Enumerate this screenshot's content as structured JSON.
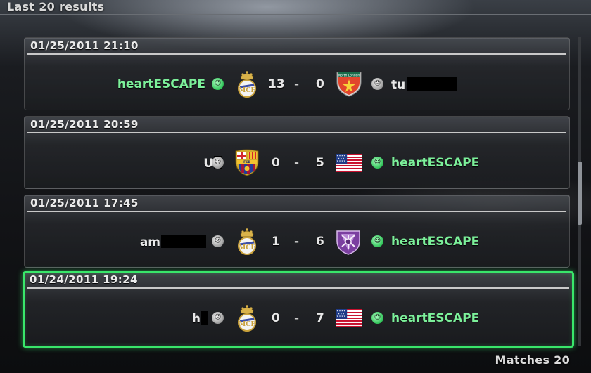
{
  "header": {
    "title": "Last 20 results"
  },
  "footer": {
    "matches_label": "Matches 20"
  },
  "colors": {
    "accent_green": "#39e66a",
    "name_green": "#7cf09a"
  },
  "results": [
    {
      "datetime": "01/25/2011 21:10",
      "home": {
        "name": "heartESCAPE",
        "name_color": "green",
        "status_icon": "green-smile-ball-icon",
        "crest": "real-madrid-crest-icon"
      },
      "home_score": "13",
      "separator": "-",
      "away_score": "0",
      "away": {
        "name": "tu",
        "name_color": "white",
        "status_icon": "grey-sad-ball-icon",
        "crest": "north-london-crest-icon"
      }
    },
    {
      "datetime": "01/25/2011 20:59",
      "home": {
        "name": "U",
        "name_color": "white",
        "status_icon": "grey-sad-ball-icon",
        "crest": "barcelona-crest-icon"
      },
      "home_score": "0",
      "separator": "-",
      "away_score": "5",
      "away": {
        "name": "heartESCAPE",
        "name_color": "green",
        "status_icon": "green-smile-ball-icon",
        "crest": "usa-flag-icon"
      }
    },
    {
      "datetime": "01/25/2011 17:45",
      "home": {
        "name": "am",
        "name_color": "white",
        "status_icon": "grey-sad-ball-icon",
        "crest": "real-madrid-crest-icon"
      },
      "home_score": "1",
      "separator": "-",
      "away_score": "6",
      "away": {
        "name": "heartESCAPE",
        "name_color": "green",
        "status_icon": "green-smile-ball-icon",
        "crest": "purple-shield-crest-icon"
      }
    },
    {
      "datetime": "01/24/2011 19:24",
      "home": {
        "name": "h",
        "name_color": "white",
        "status_icon": "grey-sad-ball-icon",
        "crest": "real-madrid-crest-icon"
      },
      "home_score": "0",
      "separator": "-",
      "away_score": "7",
      "away": {
        "name": "heartESCAPE",
        "name_color": "green",
        "status_icon": "green-smile-ball-icon",
        "crest": "usa-flag-icon"
      },
      "selected": true
    }
  ]
}
